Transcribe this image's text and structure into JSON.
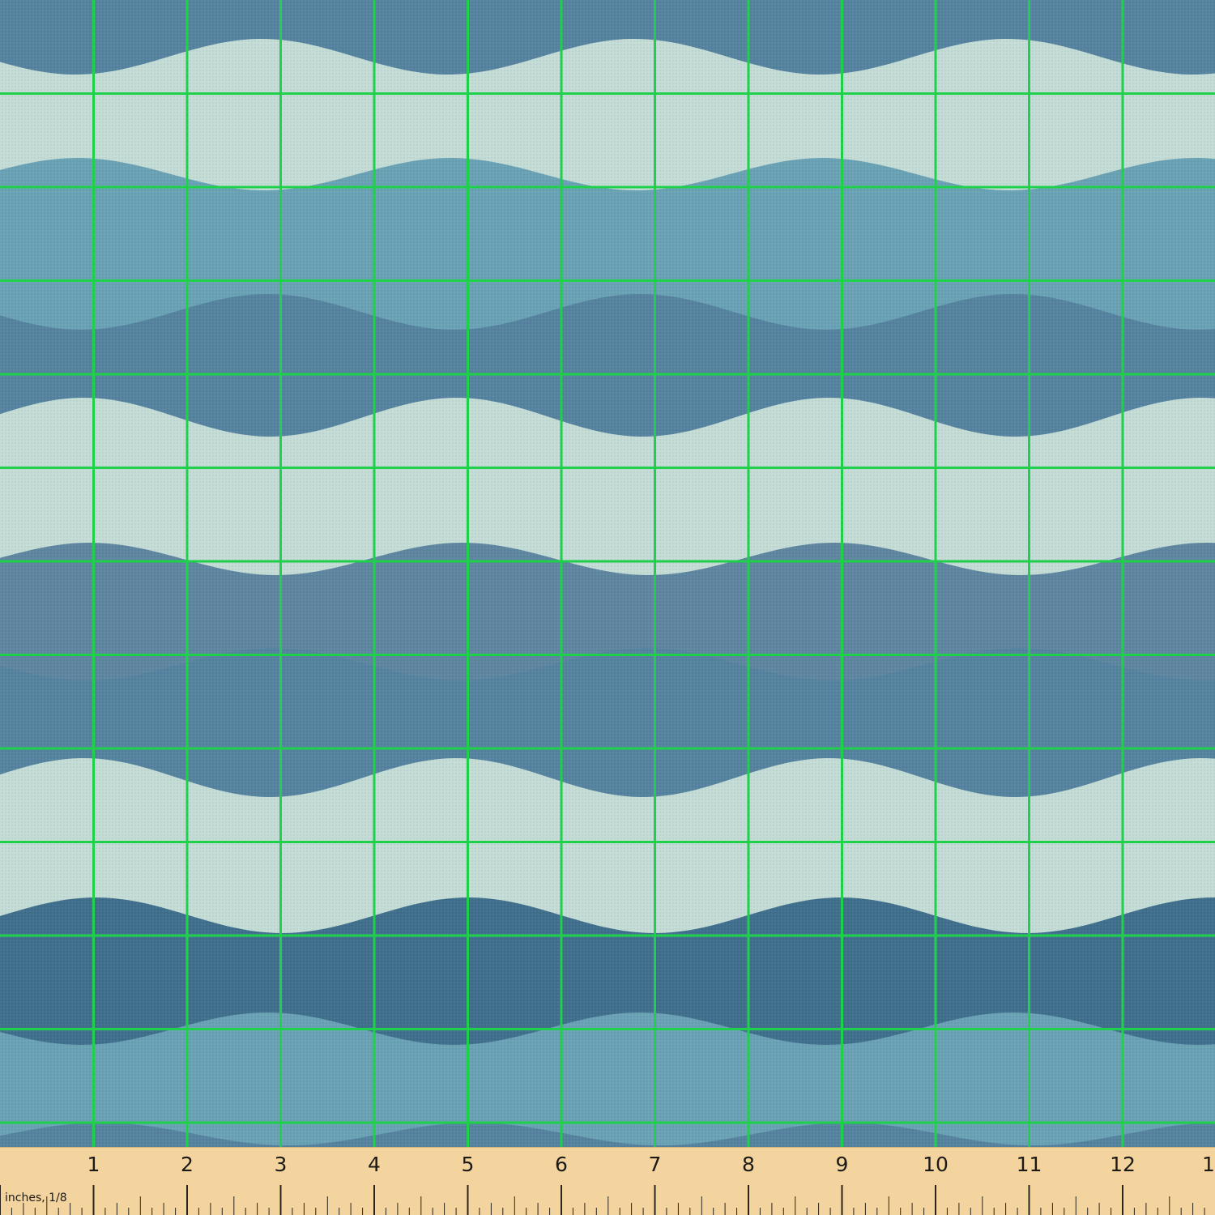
{
  "photo": {
    "subject": "wave-pattern-fabric",
    "colors": {
      "navy": "#3f6f8d",
      "steel": "#55839f",
      "slate": "#5f86a0",
      "teal": "#6aa2b5",
      "mint": "#c3dcd5",
      "grid": "#1fd14a"
    }
  },
  "ruler": {
    "unit_label": "inches, 1/8",
    "numbers": [
      "1",
      "2",
      "3",
      "4",
      "5",
      "6",
      "7",
      "8",
      "9",
      "10",
      "11",
      "12",
      "1"
    ]
  }
}
